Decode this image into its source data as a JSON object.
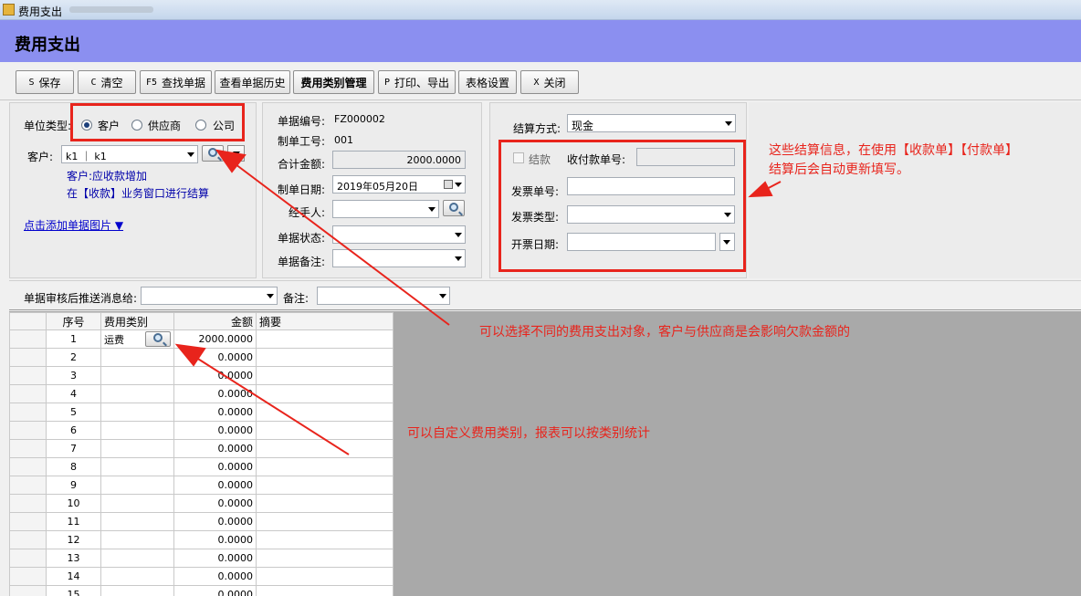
{
  "window": {
    "title": "费用支出"
  },
  "header": {
    "title": "费用支出"
  },
  "toolbar": {
    "save": {
      "key": "S",
      "label": "保存"
    },
    "clear": {
      "key": "C",
      "label": "清空"
    },
    "find": {
      "key": "F5",
      "label": "查找单据"
    },
    "history": {
      "label": "查看单据历史"
    },
    "category_mgmt": {
      "label": "费用类别管理"
    },
    "print": {
      "key": "P",
      "label": "打印、导出"
    },
    "table_settings": {
      "label": "表格设置"
    },
    "close": {
      "key": "X",
      "label": "关闭"
    }
  },
  "left": {
    "unit_type_label": "单位类型:",
    "options": [
      "客户",
      "供应商",
      "公司"
    ],
    "selected": "客户",
    "customer_label": "客户:",
    "customer_value": "k1 ｜ k1",
    "hint1": "客户:应收款增加",
    "hint2": "在【收款】业务窗口进行结算",
    "add_image_link": "点击添加单据图片 ▼"
  },
  "mid": {
    "doc_no_label": "单据编号:",
    "doc_no": "FZ000002",
    "maker_label": "制单工号:",
    "maker": "001",
    "total_label": "合计金额:",
    "total": "2000.0000",
    "date_label": "制单日期:",
    "date": "2019年05月20日",
    "handler_label": "经手人:",
    "status_label": "单据状态:",
    "remark_label": "单据备注:"
  },
  "settle": {
    "method_label": "结算方式:",
    "method": "现金",
    "settled_label": "结款",
    "receipt_no_label": "收付款单号:",
    "invoice_no_label": "发票单号:",
    "invoice_type_label": "发票类型:",
    "invoice_date_label": "开票日期:"
  },
  "push": {
    "label": "单据审核后推送消息给:",
    "remark_label": "备注:"
  },
  "grid": {
    "headers": [
      "序号",
      "费用类别",
      "金额",
      "摘要"
    ],
    "rows": [
      {
        "no": "1",
        "category": "运费",
        "amount": "2000.0000"
      },
      {
        "no": "2",
        "category": "",
        "amount": "0.0000"
      },
      {
        "no": "3",
        "category": "",
        "amount": "0.0000"
      },
      {
        "no": "4",
        "category": "",
        "amount": "0.0000"
      },
      {
        "no": "5",
        "category": "",
        "amount": "0.0000"
      },
      {
        "no": "6",
        "category": "",
        "amount": "0.0000"
      },
      {
        "no": "7",
        "category": "",
        "amount": "0.0000"
      },
      {
        "no": "8",
        "category": "",
        "amount": "0.0000"
      },
      {
        "no": "9",
        "category": "",
        "amount": "0.0000"
      },
      {
        "no": "10",
        "category": "",
        "amount": "0.0000"
      },
      {
        "no": "11",
        "category": "",
        "amount": "0.0000"
      },
      {
        "no": "12",
        "category": "",
        "amount": "0.0000"
      },
      {
        "no": "13",
        "category": "",
        "amount": "0.0000"
      },
      {
        "no": "14",
        "category": "",
        "amount": "0.0000"
      },
      {
        "no": "15",
        "category": "",
        "amount": "0.0000"
      }
    ]
  },
  "annotations": {
    "settle_note_1": "这些结算信息，在使用【收款单】【付款单】",
    "settle_note_2": "结算后会自动更新填写。",
    "object_note": "可以选择不同的费用支出对象，客户与供应商是会影响欠款金额的",
    "category_note": "可以自定义费用类别，报表可以按类别统计",
    "color": "#e8241c"
  }
}
